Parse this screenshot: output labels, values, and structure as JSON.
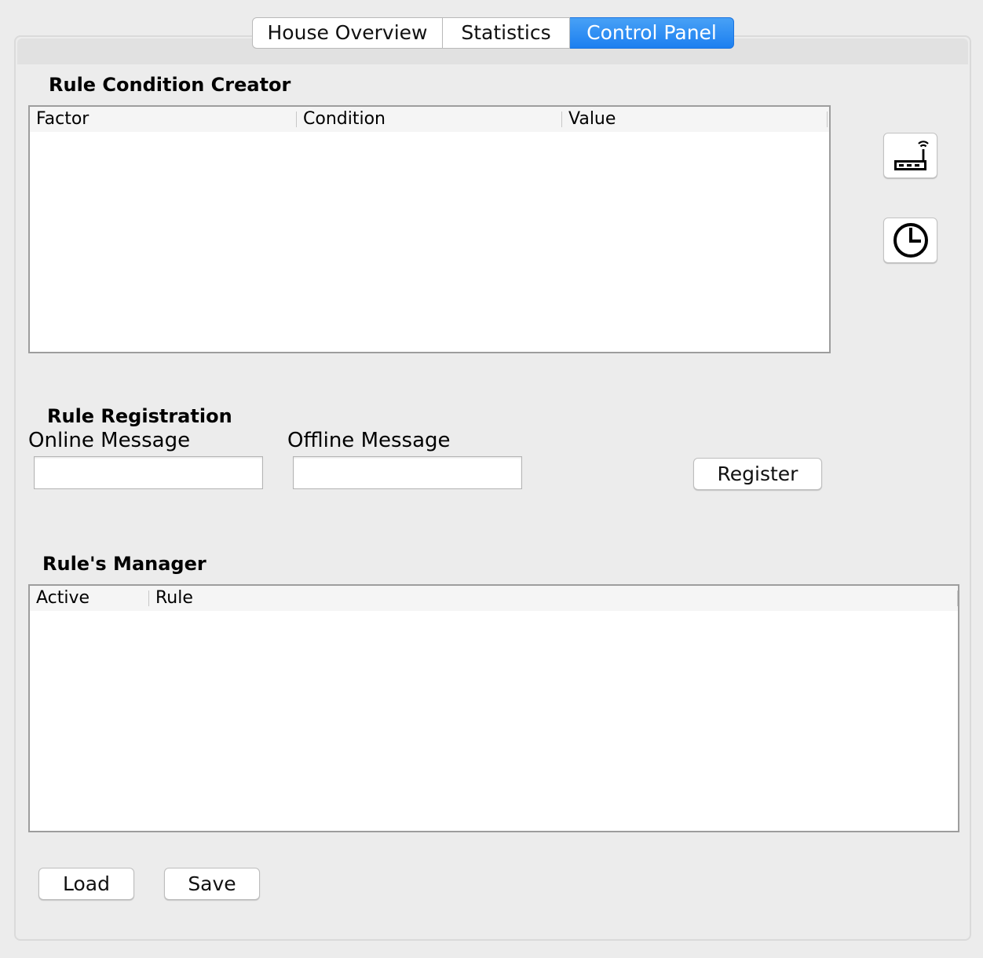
{
  "tabs": [
    {
      "label": "House Overview",
      "active": false
    },
    {
      "label": "Statistics",
      "active": false
    },
    {
      "label": "Control Panel",
      "active": true
    }
  ],
  "rule_condition_creator": {
    "title": "Rule Condition Creator",
    "columns": [
      "Factor",
      "Condition",
      "Value"
    ],
    "rows": []
  },
  "side_buttons": [
    {
      "icon": "router-icon"
    },
    {
      "icon": "clock-icon"
    }
  ],
  "rule_registration": {
    "title": "Rule Registration",
    "online_label": "Online Message",
    "online_value": "",
    "offline_label": "Offline Message",
    "offline_value": "",
    "register_label": "Register"
  },
  "rules_manager": {
    "title": "Rule's Manager",
    "columns": [
      "Active",
      "Rule"
    ],
    "rows": []
  },
  "footer": {
    "load_label": "Load",
    "save_label": "Save"
  },
  "colors": {
    "active_tab": "#1c7ff0",
    "background": "#ececec"
  }
}
